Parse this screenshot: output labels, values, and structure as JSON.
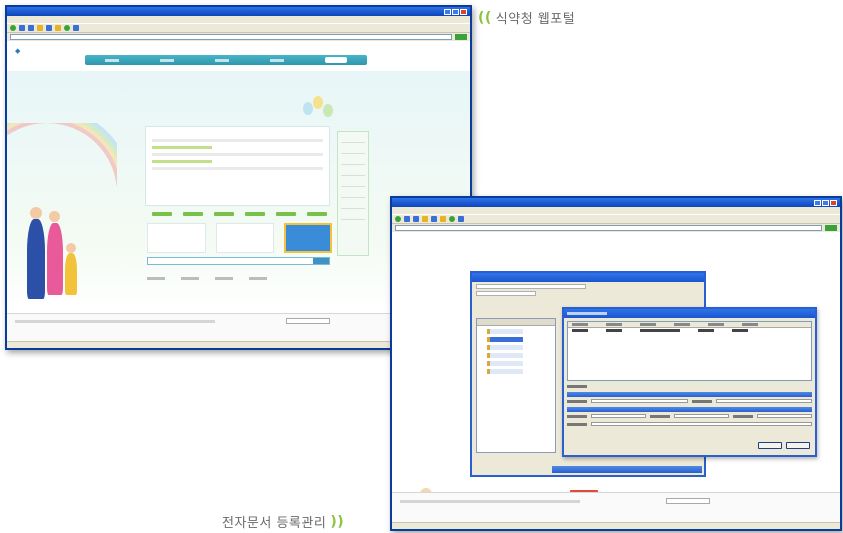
{
  "captions": {
    "top": {
      "arrows": "((",
      "text": "식약청 웹포털"
    },
    "bottom": {
      "text": "전자문서 등록관리",
      "arrows": "))"
    }
  },
  "colors": {
    "xp_title_blue": "#1a56cf",
    "portal_nav_teal": "#2f97ad",
    "caption_accent_green": "#8cc43e",
    "caption_text_gray": "#6a6a6a"
  },
  "window_portal": {
    "icons": [
      "back-icon",
      "forward-icon",
      "refresh-icon",
      "home-icon",
      "search-icon",
      "favorites-icon",
      "mail-icon",
      "print-icon"
    ]
  },
  "window_edoc": {
    "icons": [
      "back-icon",
      "forward-icon",
      "refresh-icon",
      "home-icon",
      "search-icon",
      "favorites-icon",
      "mail-icon",
      "print-icon"
    ]
  }
}
